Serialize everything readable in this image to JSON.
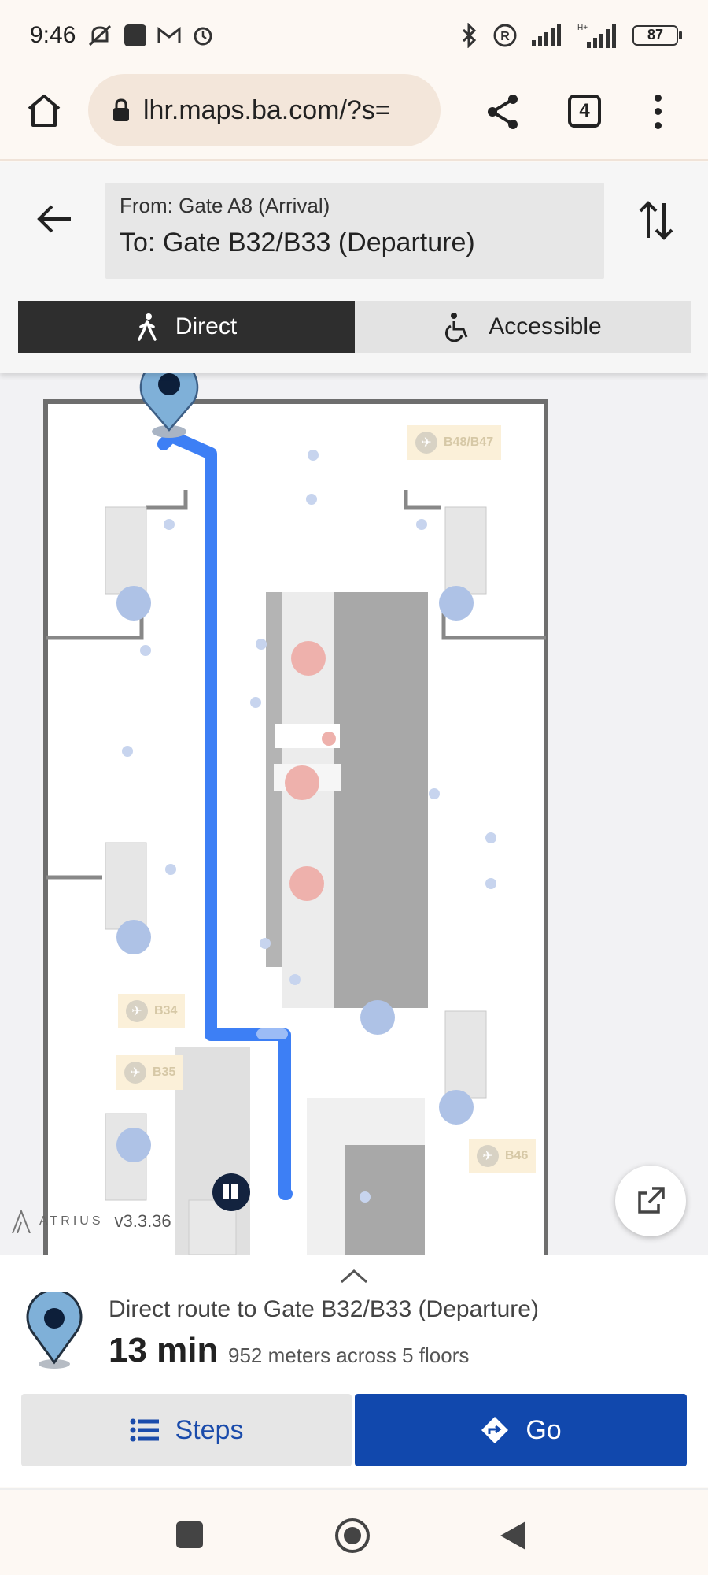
{
  "status_bar": {
    "time": "9:46",
    "battery": "87",
    "icons": [
      "mute-icon",
      "app-icon",
      "gmail-icon",
      "alarm-icon",
      "bluetooth-icon",
      "registered-icon",
      "signal-icon",
      "signal-hplus-icon",
      "battery-icon"
    ]
  },
  "browser": {
    "url": "lhr.maps.ba.com/?s=",
    "tab_count": "4",
    "icons": [
      "home-icon",
      "lock-icon",
      "share-icon",
      "tabs-icon",
      "more-vert-icon"
    ]
  },
  "route": {
    "from_label": "From:",
    "from_value": "Gate A8 (Arrival)",
    "to_label": "To:",
    "to_value": "Gate B32/B33 (Departure)",
    "modes": [
      {
        "label": "Direct",
        "icon": "walk-icon",
        "active": true
      },
      {
        "label": "Accessible",
        "icon": "wheelchair-icon",
        "active": false
      }
    ]
  },
  "map": {
    "gate_labels": [
      "B48/B47",
      "B34",
      "B35",
      "B46"
    ],
    "brand": "ATRIUS",
    "version": "v3.3.36",
    "route_color": "#3d7ff5",
    "pin_color": "#7fb0d8"
  },
  "sheet": {
    "title": "Direct route to Gate B32/B33 (Departure)",
    "time": "13 min",
    "detail": "952 meters across 5 floors",
    "steps_label": "Steps",
    "go_label": "Go",
    "accent": "#1148ad"
  }
}
